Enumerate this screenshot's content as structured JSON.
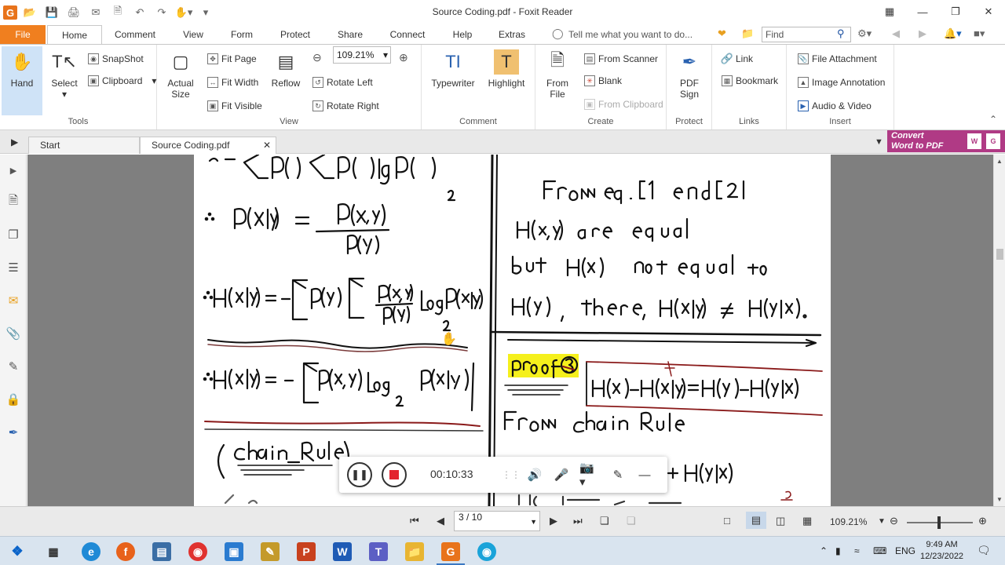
{
  "window": {
    "title": "Source Coding.pdf - Foxit Reader"
  },
  "tabs": {
    "file": "File",
    "home": "Home",
    "comment": "Comment",
    "view": "View",
    "form": "Form",
    "protect": "Protect",
    "share": "Share",
    "connect": "Connect",
    "help": "Help",
    "extras": "Extras",
    "tell_me_placeholder": "Tell me what you want to do...",
    "find_placeholder": "Find"
  },
  "ribbon": {
    "tools": {
      "label": "Tools",
      "hand": "Hand",
      "select": "Select",
      "snapshot": "SnapShot",
      "clipboard": "Clipboard"
    },
    "view": {
      "label": "View",
      "actual_size_1": "Actual",
      "actual_size_2": "Size",
      "fit_page": "Fit Page",
      "fit_width": "Fit Width",
      "fit_visible": "Fit Visible",
      "reflow": "Reflow",
      "zoom_value": "109.21%",
      "rotate_left": "Rotate Left",
      "rotate_right": "Rotate Right"
    },
    "comment": {
      "label": "Comment",
      "typewriter": "Typewriter",
      "highlight": "Highlight"
    },
    "create": {
      "label": "Create",
      "from_file_1": "From",
      "from_file_2": "File",
      "from_scanner": "From Scanner",
      "blank": "Blank",
      "from_clipboard": "From Clipboard"
    },
    "protect": {
      "label": "Protect",
      "pdf_sign_1": "PDF",
      "pdf_sign_2": "Sign"
    },
    "links": {
      "label": "Links",
      "link": "Link",
      "bookmark": "Bookmark"
    },
    "insert": {
      "label": "Insert",
      "file_attachment": "File Attachment",
      "image_annotation": "Image Annotation",
      "audio_video": "Audio & Video"
    }
  },
  "doc_tabs": {
    "start": "Start",
    "active": "Source Coding.pdf",
    "convert_line1": "Convert",
    "convert_line2": "Word to PDF"
  },
  "recorder": {
    "time": "00:10:33"
  },
  "status": {
    "page_indicator": "3 / 10",
    "zoom": "109.21%"
  },
  "taskbar": {
    "language": "ENG",
    "time": "9:49 AM",
    "date": "12/23/2022"
  },
  "colors": {
    "file_tab": "#f07f1f",
    "convert_banner": "#b03a85",
    "selected_tool": "#cfe3f7",
    "highlight_yellow": "#f5f01c"
  }
}
